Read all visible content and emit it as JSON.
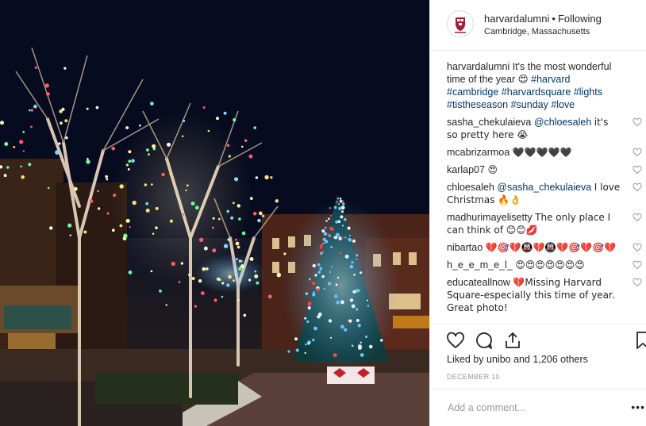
{
  "post": {
    "username": "harvardalumni",
    "separator": "•",
    "follow_state": "Following",
    "location": "Cambridge, Massachusetts",
    "caption_user": "harvardalumni",
    "caption_text": "It's the most wonderful time of the year 😍",
    "hashtags": "#harvard #cambridge #harvardsquare #lights #tistheseason #sunday #love"
  },
  "comments": [
    {
      "user": "sasha_chekulaieva",
      "mention": "@chloesaleh",
      "text": "it's so pretty here 😭"
    },
    {
      "user": "mcabrizarmoa",
      "mention": "",
      "text": "🖤🖤🖤🖤🖤"
    },
    {
      "user": "karlap07",
      "mention": "",
      "text": "😍"
    },
    {
      "user": "chloesaleh",
      "mention": "@sasha_chekulaieva",
      "text": "I love Christmas 🔥👌"
    },
    {
      "user": "madhurimayelisetty",
      "mention": "",
      "text": "The only place I can think of 😊😊💋"
    },
    {
      "user": "nibartao",
      "mention": "",
      "text": "💔🎯💔🚇💔🚇💔🎯💔🎯💔"
    },
    {
      "user": "h_e_e_m_e_l_",
      "mention": "",
      "text": "😍😍😍😍😍😍😍"
    },
    {
      "user": "educateallnow",
      "mention": "",
      "text": "💔Missing Harvard Square-especially this time of year. Great photo!"
    }
  ],
  "likes_text": "Liked by unibo and 1,206 others",
  "date": "DECEMBER 10",
  "add_comment_placeholder": "Add a comment...",
  "more_label": "•••",
  "colors": {
    "link": "#003569",
    "text": "#262626",
    "muted": "#999999",
    "harvard_crimson": "#a51c30"
  },
  "icons": [
    "heart-icon",
    "comment-icon",
    "share-icon",
    "bookmark-icon",
    "harvard-shield-icon"
  ]
}
